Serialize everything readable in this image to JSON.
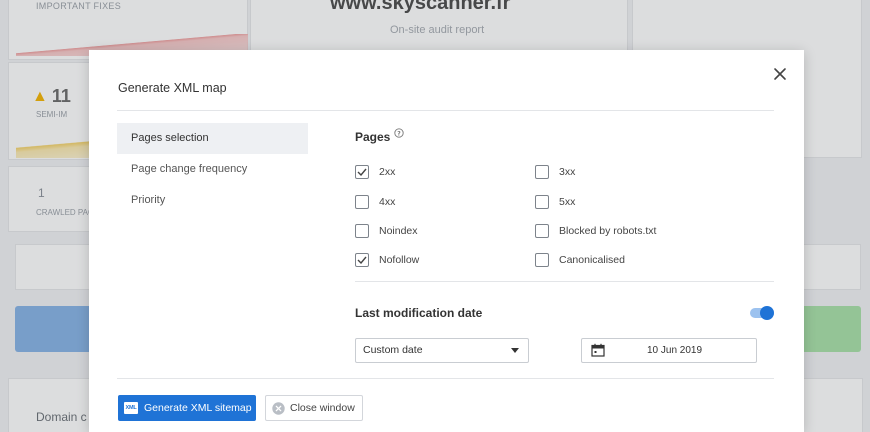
{
  "background": {
    "fixes_label": "IMPORTANT FIXES",
    "domain": "www.skyscanner.fr",
    "subtitle": "On-site audit report",
    "warning_count": "11",
    "semi_label": "SEMI-IM",
    "crawled_count": "1",
    "crawled_label": "CRAWLED PAG",
    "domain_c_label": "Domain c"
  },
  "modal": {
    "title": "Generate XML map",
    "sidebar": [
      {
        "label": "Pages selection",
        "active": true
      },
      {
        "label": "Page change frequency",
        "active": false
      },
      {
        "label": "Priority",
        "active": false
      }
    ],
    "pages_heading": "Pages",
    "checkboxes": [
      {
        "label": "2xx",
        "checked": true
      },
      {
        "label": "3xx",
        "checked": false
      },
      {
        "label": "4xx",
        "checked": false
      },
      {
        "label": "5xx",
        "checked": false
      },
      {
        "label": "Noindex",
        "checked": false
      },
      {
        "label": "Blocked by robots.txt",
        "checked": false
      },
      {
        "label": "Nofollow",
        "checked": true
      },
      {
        "label": "Canonicalised",
        "checked": false
      }
    ],
    "last_mod_heading": "Last modification date",
    "last_mod_enabled": true,
    "date_mode": "Custom date",
    "date_value": "10 Jun 2019",
    "generate_button": "Generate XML sitemap",
    "xml_badge": "XML",
    "close_button": "Close window"
  },
  "colors": {
    "accent": "#1f73d6",
    "warning": "#f5b400"
  }
}
